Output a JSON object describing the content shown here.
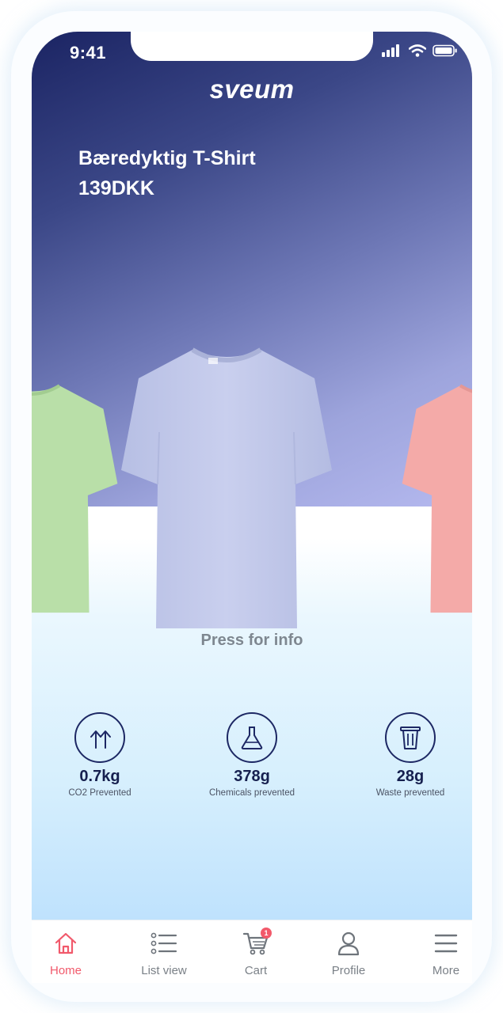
{
  "status_bar": {
    "time": "9:41"
  },
  "brand": {
    "name": "sveum"
  },
  "product": {
    "name": "Bæredyktig T-Shirt",
    "price": "139DKK",
    "hint": "Press for info",
    "carousel_colors": {
      "left": "#b9dfa8",
      "center": "#c3cae9",
      "right": "#f4aaa8"
    }
  },
  "stats": [
    {
      "icon": "co2-arrows-icon",
      "value": "0.7kg",
      "label": "CO2 Prevented"
    },
    {
      "icon": "flask-icon",
      "value": "378g",
      "label": "Chemicals prevented"
    },
    {
      "icon": "trash-bin-icon",
      "value": "28g",
      "label": "Waste prevented"
    }
  ],
  "tabbar": {
    "active": "Home",
    "items": [
      {
        "icon": "home-icon",
        "label": "Home"
      },
      {
        "icon": "list-icon",
        "label": "List view"
      },
      {
        "icon": "cart-icon",
        "label": "Cart",
        "badge": "1"
      },
      {
        "icon": "profile-icon",
        "label": "Profile"
      },
      {
        "icon": "menu-icon",
        "label": "More"
      }
    ]
  },
  "colors": {
    "hero_dark": "#1b2463",
    "hero_light": "#b5b9ef",
    "accent": "#f1596b",
    "navy": "#1d2864"
  }
}
